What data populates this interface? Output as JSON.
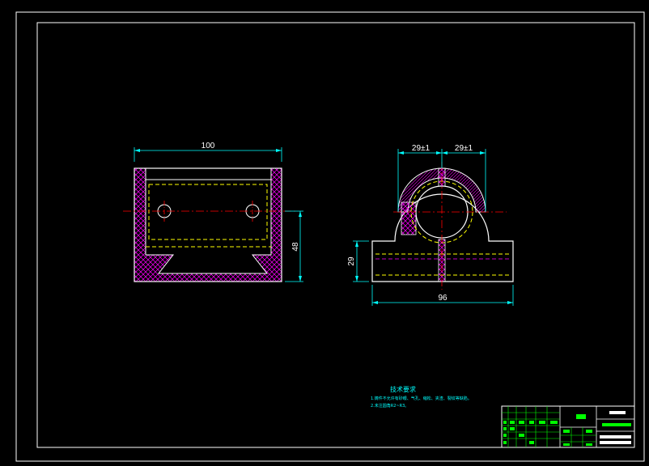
{
  "front_view": {
    "dim_width": "100",
    "dim_height": "48"
  },
  "side_view": {
    "dim_left_half": "29±1",
    "dim_right_half": "29±1",
    "dim_height": "29",
    "dim_base_width": "96"
  },
  "technical_requirements": {
    "title": "技术要求",
    "notes": [
      "1.铸件不允许有砂眼、气孔、缩松、夹渣、裂纹等缺陷。",
      "2.未注圆角R2~R3。"
    ]
  },
  "colors": {
    "frame": "#ffffff",
    "outline": "#ffffff",
    "center_line": "#ff0000",
    "hidden_line": "#ffff00",
    "hatch": "#ff00ff",
    "dimension": "#00ffff",
    "title_block": "#00ff00"
  }
}
